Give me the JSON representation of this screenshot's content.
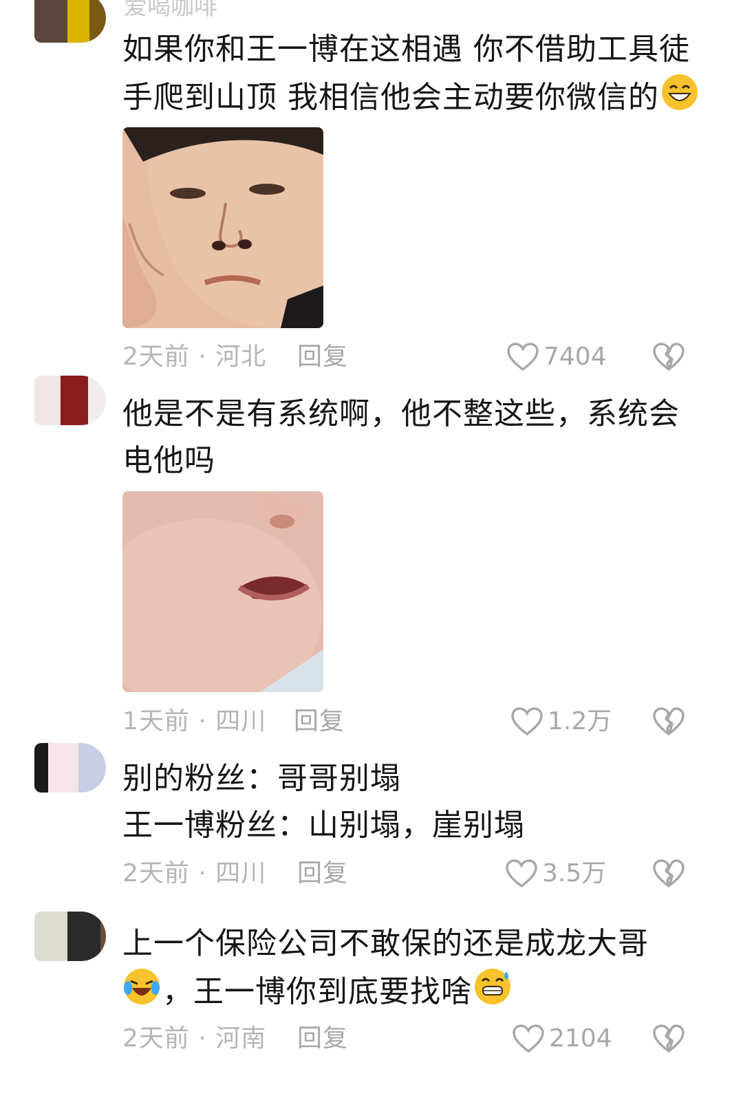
{
  "comments": [
    {
      "username": "爱喝咖啡",
      "lines": [
        "如果你和王一博在这相遇 你不借助工具徒",
        "手爬到山顶 我相信他会主动要你微信的"
      ],
      "time": "2天前",
      "location": "河北",
      "reply_label": "回复",
      "likes": "7404",
      "image": "face-with-hand-on-cheek",
      "trailing_emoji": "grin-emoji"
    },
    {
      "lines": [
        "他是不是有系统啊，他不整这些，系统会",
        "电他吗"
      ],
      "time": "1天前",
      "location": "四川",
      "reply_label": "回复",
      "likes": "1.2万",
      "image": "baby-face-closeup"
    },
    {
      "lines": [
        "别的粉丝：哥哥别塌",
        "王一博粉丝：山别塌，崖别塌"
      ],
      "time": "2天前",
      "location": "四川",
      "reply_label": "回复",
      "likes": "3.5万"
    },
    {
      "lines": [
        "上一个保险公司不敢保的还是成龙大哥",
        "，王一博你到底要找啥"
      ],
      "time": "2天前",
      "location": "河南",
      "reply_label": "回复",
      "likes": "2104",
      "leading_emoji": "laugh-cry-emoji",
      "trailing_emoji": "sweat-grin-emoji"
    }
  ],
  "meta_separator": "·",
  "colors": {
    "text": "#161616",
    "meta": "#b5b5b5",
    "icon": "#a8a8a8"
  }
}
